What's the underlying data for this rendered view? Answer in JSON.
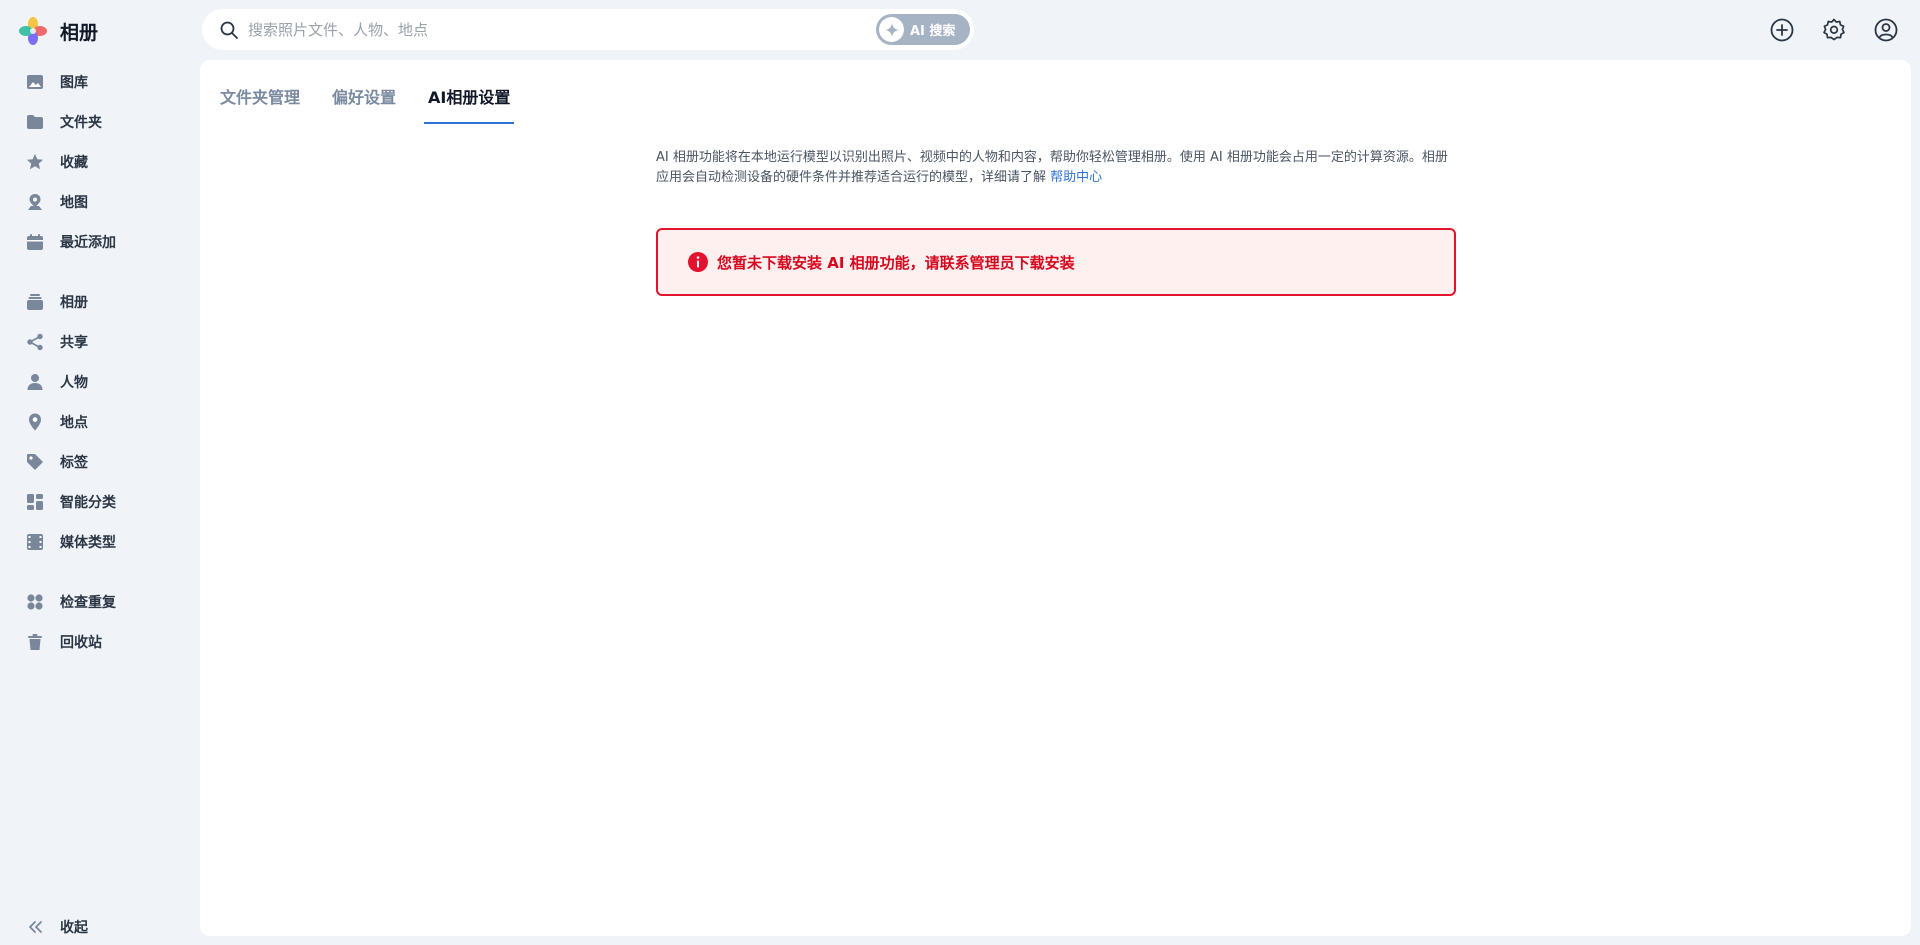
{
  "app": {
    "title": "相册"
  },
  "sidebar": {
    "items": [
      {
        "label": "图库",
        "icon": "image-icon"
      },
      {
        "label": "文件夹",
        "icon": "folder-icon"
      },
      {
        "label": "收藏",
        "icon": "star-icon"
      },
      {
        "label": "地图",
        "icon": "map-pin-icon"
      },
      {
        "label": "最近添加",
        "icon": "calendar-icon"
      },
      {
        "label": "相册",
        "icon": "album-stack-icon"
      },
      {
        "label": "共享",
        "icon": "share-icon"
      },
      {
        "label": "人物",
        "icon": "person-icon"
      },
      {
        "label": "地点",
        "icon": "location-icon"
      },
      {
        "label": "标签",
        "icon": "tag-icon"
      },
      {
        "label": "智能分类",
        "icon": "smart-category-icon"
      },
      {
        "label": "媒体类型",
        "icon": "film-icon"
      },
      {
        "label": "检查重复",
        "icon": "duplicates-icon"
      },
      {
        "label": "回收站",
        "icon": "trash-icon"
      }
    ],
    "collapse_label": "收起"
  },
  "search": {
    "placeholder": "搜索照片文件、人物、地点",
    "ai_button_label": "AI 搜索"
  },
  "tabs": [
    {
      "label": "文件夹管理",
      "active": false
    },
    {
      "label": "偏好设置",
      "active": false
    },
    {
      "label": "AI相册设置",
      "active": true
    }
  ],
  "content": {
    "description": "AI 相册功能将在本地运行模型以识别出照片、视频中的人物和内容，帮助你轻松管理相册。使用 AI 相册功能会占用一定的计算资源。相册应用会自动检测设备的硬件条件并推荐适合运行的模型，详细请了解 ",
    "help_link": "帮助中心",
    "alert_text": "您暂未下载安装 AI 相册功能，请联系管理员下载安装"
  },
  "colors": {
    "accent": "#2f74d6",
    "alert_red": "#e3122e",
    "alert_bg": "#fff0f0",
    "icon_gray": "#7a879a"
  }
}
